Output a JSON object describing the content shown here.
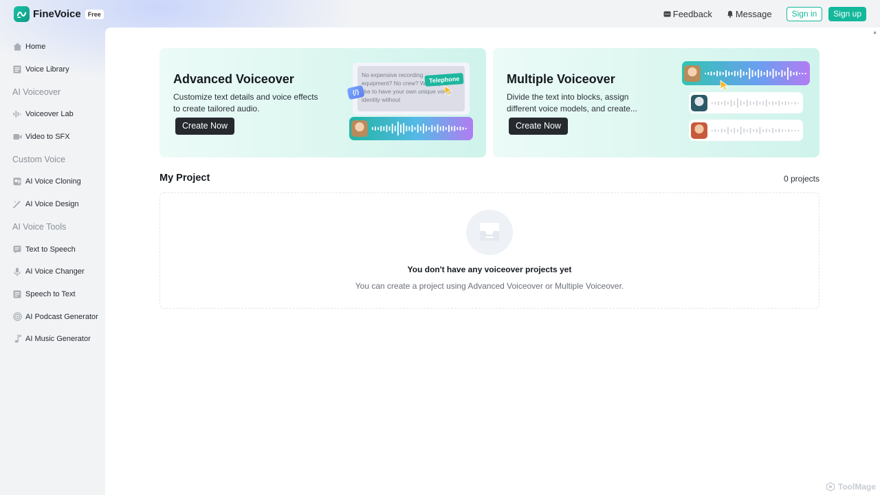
{
  "app": {
    "name": "FineVoice",
    "plan": "Free"
  },
  "header": {
    "feedback": "Feedback",
    "message": "Message",
    "sign_in": "Sign in",
    "sign_up": "Sign up"
  },
  "sidebar": {
    "home": "Home",
    "voice_library": "Voice Library",
    "section_ai_voiceover": "AI Voiceover",
    "voiceover_lab": "Voiceover Lab",
    "video_to_sfx": "Video to SFX",
    "section_custom_voice": "Custom Voice",
    "ai_voice_cloning": "AI Voice Cloning",
    "ai_voice_design": "AI Voice Design",
    "section_ai_voice_tools": "AI Voice Tools",
    "text_to_speech": "Text to Speech",
    "ai_voice_changer": "AI Voice Changer",
    "speech_to_text": "Speech to Text",
    "ai_podcast_generator": "AI Podcast Generator",
    "ai_music_generator": "AI Music Generator"
  },
  "cards": {
    "advanced": {
      "title": "Advanced Voiceover",
      "description": "Customize text details and voice effects to create tailored audio.",
      "button": "Create Now",
      "illus_text": "No expensive recording equipment? No crew? Would you like to have your own unique voice identity without",
      "illus_tag": "Telephone"
    },
    "multiple": {
      "title": "Multiple Voiceover",
      "description": "Divide the text into blocks, assign different voice models, and create...",
      "button": "Create Now"
    }
  },
  "projects": {
    "title": "My Project",
    "count": "0 projects",
    "empty_title": "You don't have any voiceover projects yet",
    "empty_desc": "You can create a project using Advanced Voiceover or Multiple Voiceover."
  },
  "watermark": "ToolMage",
  "colors": {
    "accent": "#14b89b",
    "dark_button": "#262a2f",
    "wave_gradient_start": "#2ec5b0",
    "wave_gradient_end": "#b27cf2"
  },
  "icons": {
    "logo": "wave-logo-icon",
    "feedback": "chat-icon",
    "message": "bell-icon",
    "home": "home-icon",
    "library": "list-icon",
    "lab": "waveform-icon",
    "sfx": "video-icon",
    "cloning": "clone-icon",
    "design": "magic-wand-icon",
    "tts": "document-icon",
    "changer": "mic-icon",
    "stt": "text-icon",
    "podcast": "podcast-icon",
    "music": "music-note-icon"
  }
}
